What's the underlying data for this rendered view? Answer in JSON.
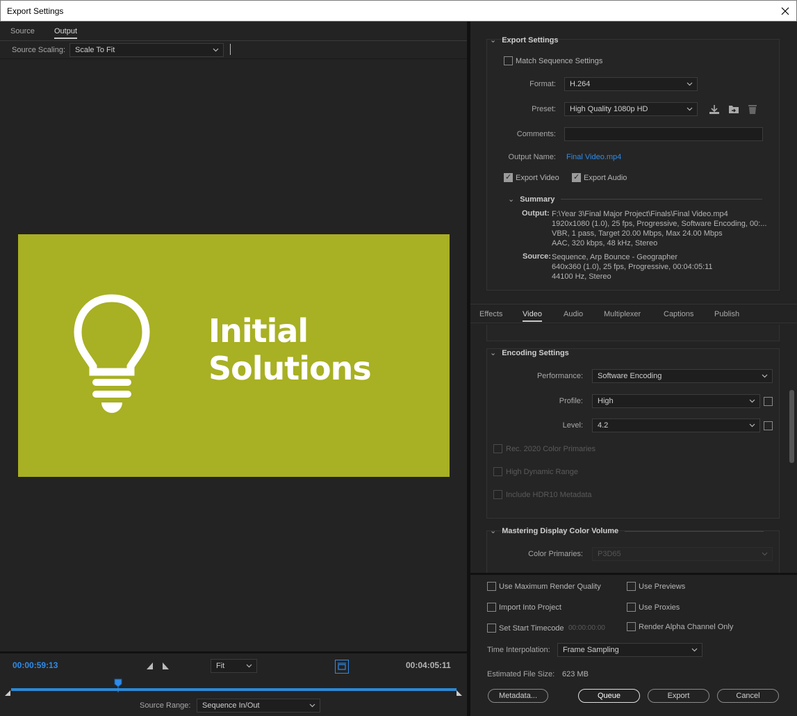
{
  "window": {
    "title": "Export Settings"
  },
  "left": {
    "tabs": [
      {
        "label": "Source"
      },
      {
        "label": "Output"
      }
    ],
    "source_scaling": {
      "label": "Source Scaling:",
      "value": "Scale To Fit"
    },
    "preview": {
      "brand_line1": "Initial",
      "brand_line2": "Solutions",
      "bg_color": "#a8b023"
    },
    "timeline": {
      "current_tc": "00:00:59:13",
      "end_tc": "00:04:05:11",
      "zoom": "Fit",
      "playhead_fraction": 0.24,
      "source_range_label": "Source Range:",
      "source_range_value": "Sequence In/Out"
    }
  },
  "export_settings": {
    "header": "Export Settings",
    "match_sequence": "Match Sequence Settings",
    "format_label": "Format:",
    "format_value": "H.264",
    "preset_label": "Preset:",
    "preset_value": "High Quality 1080p HD",
    "comments_label": "Comments:",
    "output_name_label": "Output Name:",
    "output_name_value": "Final Video.mp4",
    "export_video": "Export Video",
    "export_audio": "Export Audio",
    "summary": {
      "header": "Summary",
      "output_label": "Output:",
      "output_lines": [
        "F:\\Year 3\\Final Major Project\\Finals\\Final Video.mp4",
        "1920x1080 (1.0), 25 fps, Progressive, Software Encoding, 00:...",
        "VBR, 1 pass, Target 20.00 Mbps, Max 24.00 Mbps",
        "AAC, 320 kbps, 48 kHz, Stereo"
      ],
      "source_label": "Source:",
      "source_lines": [
        "Sequence, Arp Bounce - Geographer",
        "640x360 (1.0), 25 fps, Progressive, 00:04:05:11",
        "44100 Hz, Stereo"
      ]
    }
  },
  "right_tabs": [
    {
      "label": "Effects"
    },
    {
      "label": "Video"
    },
    {
      "label": "Audio"
    },
    {
      "label": "Multiplexer"
    },
    {
      "label": "Captions"
    },
    {
      "label": "Publish"
    }
  ],
  "encoding": {
    "header": "Encoding Settings",
    "performance_label": "Performance:",
    "performance_value": "Software Encoding",
    "profile_label": "Profile:",
    "profile_value": "High",
    "level_label": "Level:",
    "level_value": "4.2",
    "rec2020": "Rec. 2020 Color Primaries",
    "hdr": "High Dynamic Range",
    "hdr10": "Include HDR10 Metadata"
  },
  "mastering": {
    "header": "Mastering Display Color Volume",
    "color_primaries_label": "Color Primaries:",
    "color_primaries_value": "P3D65"
  },
  "bottom": {
    "max_render": "Use Maximum Render Quality",
    "use_previews": "Use Previews",
    "import_project": "Import Into Project",
    "use_proxies": "Use Proxies",
    "set_start_tc": "Set Start Timecode",
    "start_tc_value": "00:00:00:00",
    "render_alpha": "Render Alpha Channel Only",
    "time_interp_label": "Time Interpolation:",
    "time_interp_value": "Frame Sampling",
    "file_size_label": "Estimated File Size:",
    "file_size_value": "623 MB",
    "buttons": {
      "metadata": "Metadata...",
      "queue": "Queue",
      "export": "Export",
      "cancel": "Cancel"
    }
  }
}
